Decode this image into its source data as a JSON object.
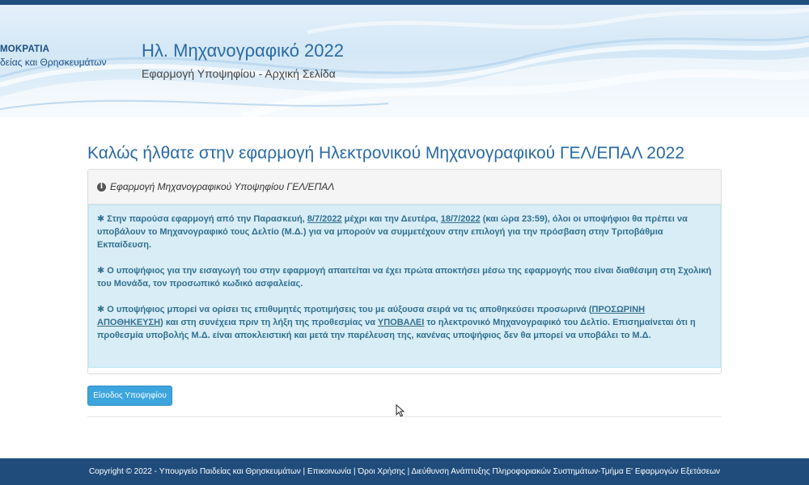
{
  "header": {
    "ministry_line1": "ΜΟΚΡΑΤΙΑ",
    "ministry_line2": "δείας και Θρησκευμάτων",
    "app_title": "Ηλ. Μηχανογραφικό 2022",
    "app_subtitle": "Εφαρμογή Υποψηφίου - Αρχική Σελίδα"
  },
  "main": {
    "welcome_title": "Καλώς ήλθατε στην εφαρμογή Ηλεκτρονικού Μηχανογραφικού ΓΕΛ/ΕΠΑΛ 2022",
    "panel_heading": "Εφαρμογή Μηχανογραφικού Υποψηφίου ΓΕΛ/ΕΠΑΛ",
    "info_icon": "info-circle-icon",
    "star_glyph": "✱",
    "para1": {
      "t1": "Στην παρούσα εφαρμογή από την Παρασκευή, ",
      "date1": "8/7/2022",
      "t2": " μέχρι και την Δευτέρα, ",
      "date2": "18/7/2022",
      "t3": " (και ώρα 23:59), όλοι οι υποψήφιοι θα πρέπει να υποβάλουν το Μηχανογραφικό τους Δελτίο (Μ.Δ.) για να μπορούν να συμμετέχουν στην επιλογή για την πρόσβαση στην Τριτοβάθμια Εκπαίδευση."
    },
    "para2": "Ο υποψήφιος για την εισαγωγή του στην εφαρμογή απαιτείται να έχει πρώτα αποκτήσει μέσω της εφαρμογής που είναι διαθέσιμη στη Σχολική του Μονάδα, τον προσωπικό κωδικό ασφαλείας.",
    "para3": {
      "t1": "Ο υποψήφιος μπορεί να ορίσει τις επιθυμητές προτιμήσεις του με αύξουσα σειρά να τις αποθηκεύσει προσωρινά (",
      "u1": "ΠΡΟΣΩΡΙΝΗ ΑΠΟΘΗΚΕΥΣΗ",
      "t2": ") και στη συνέχεια πριν τη λήξη της προθεσμίας να ",
      "u2": "ΥΠΟΒΑΛΕΙ",
      "t3": " το ηλεκτρονικό Μηχανογραφικό του Δελτίο. Επισημαίνεται ότι η προθεσμία υποβολής Μ.Δ. είναι αποκλειστική και μετά την παρέλευση της, κανένας υποψήφιος δεν θα μπορεί να υποβάλει το Μ.Δ."
    },
    "login_button": "Είσοδος Υποψηφίου"
  },
  "footer": {
    "text": "Copyright © 2022 - Υπουργείο Παιδείας και Θρησκευμάτων | Επικοινωνία | Όροι Χρήσης | Διεύθυνση Ανάπτυξης Πληροφοριακών Συστημάτων-Τμήμα Ε' Εφαρμογών Εξετάσεων"
  },
  "colors": {
    "accent": "#2b6aa4",
    "alert_bg": "#d9edf7",
    "alert_text": "#31708f",
    "button": "#3da5dd",
    "footer_bg": "#204c7c"
  }
}
